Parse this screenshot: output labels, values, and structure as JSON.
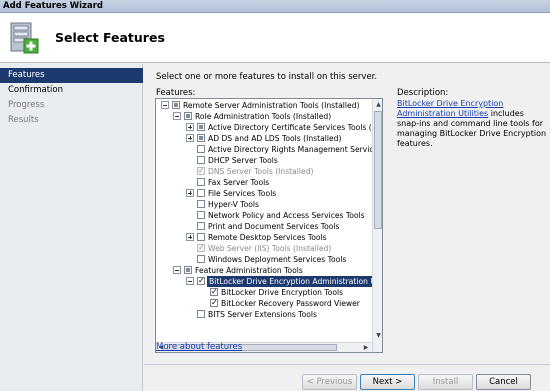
{
  "window": {
    "title": "Add Features Wizard"
  },
  "header": {
    "title": "Select Features"
  },
  "nav": {
    "items": [
      {
        "label": "Features"
      },
      {
        "label": "Confirmation"
      },
      {
        "label": "Progress"
      },
      {
        "label": "Results"
      }
    ]
  },
  "main": {
    "intro": "Select one or more features to install on this server.",
    "features_label": "Features:",
    "description_label": "Description:",
    "description_link": "BitLocker Drive Encryption Administration Utilities",
    "description_text": " includes snap-ins and command line tools for managing BitLocker Drive Encryption features.",
    "more_link": "More about features"
  },
  "tree": {
    "items": [
      {
        "label": "Remote Server Administration Tools  (Installed)"
      },
      {
        "label": "Role Administration Tools  (Installed)"
      },
      {
        "label": "Active Directory Certificate Services Tools  (Insta"
      },
      {
        "label": "AD DS and AD LDS Tools  (Installed)"
      },
      {
        "label": "Active Directory Rights Management Services Too"
      },
      {
        "label": "DHCP Server Tools"
      },
      {
        "label": "DNS Server Tools  (Installed)"
      },
      {
        "label": "Fax Server Tools"
      },
      {
        "label": "File Services Tools"
      },
      {
        "label": "Hyper-V Tools"
      },
      {
        "label": "Network Policy and Access Services Tools"
      },
      {
        "label": "Print and Document Services Tools"
      },
      {
        "label": "Remote Desktop Services Tools"
      },
      {
        "label": "Web Server (IIS) Tools  (Installed)"
      },
      {
        "label": "Windows Deployment Services Tools"
      },
      {
        "label": "Feature Administration Tools"
      },
      {
        "label": "BitLocker Drive Encryption Administration Utilities"
      },
      {
        "label": "BitLocker Drive Encryption Tools"
      },
      {
        "label": "BitLocker Recovery Password Viewer"
      },
      {
        "label": "BITS Server Extensions Tools"
      }
    ]
  },
  "buttons": {
    "previous": "< Previous",
    "next": "Next >",
    "install": "Install",
    "cancel": "Cancel"
  }
}
